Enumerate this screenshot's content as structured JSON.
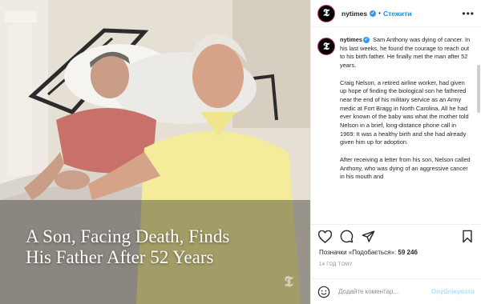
{
  "photo": {
    "headline_line1": "A Son, Facing Death, Finds",
    "headline_line2": "His Father After 52 Years",
    "watermark": "𝕿"
  },
  "header": {
    "avatar_letter": "𝕿",
    "username": "nytimes",
    "separator": "•",
    "follow_label": "Стежити",
    "more_label": "•••"
  },
  "caption": {
    "username": "nytimes",
    "p1": "Sam Anthony was dying of cancer. In his last weeks, he found the courage to reach out to his birth father. He finally met the man after 52 years.",
    "p2": "Craig Nelson, a retired airline worker, had given up hope of finding the biological son he fathered near the end of his military service as an Army medic at Fort Bragg in North Carolina. All he had ever known of the baby was what the mother told Nelson in a brief, long-distance phone call in 1969: It was a healthy birth and she had already given him up for adoption.",
    "p3": "After receiving a letter from his son, Nelson called Anthony, who was dying of an aggressive cancer in his mouth and"
  },
  "actions": {
    "icons": [
      "heart-icon",
      "comment-icon",
      "share-icon",
      "bookmark-icon"
    ]
  },
  "likes": {
    "label": "Позначки «Подобається»:",
    "count": "59 246"
  },
  "timestamp": "14 год тому",
  "comment": {
    "placeholder": "Додайте коментар...",
    "publish_label": "Опублікувати"
  },
  "colors": {
    "accent": "#0095f6",
    "verified": "#3897f0",
    "publish_disabled": "#b2dffc",
    "avatar_ring": "#c13584"
  }
}
